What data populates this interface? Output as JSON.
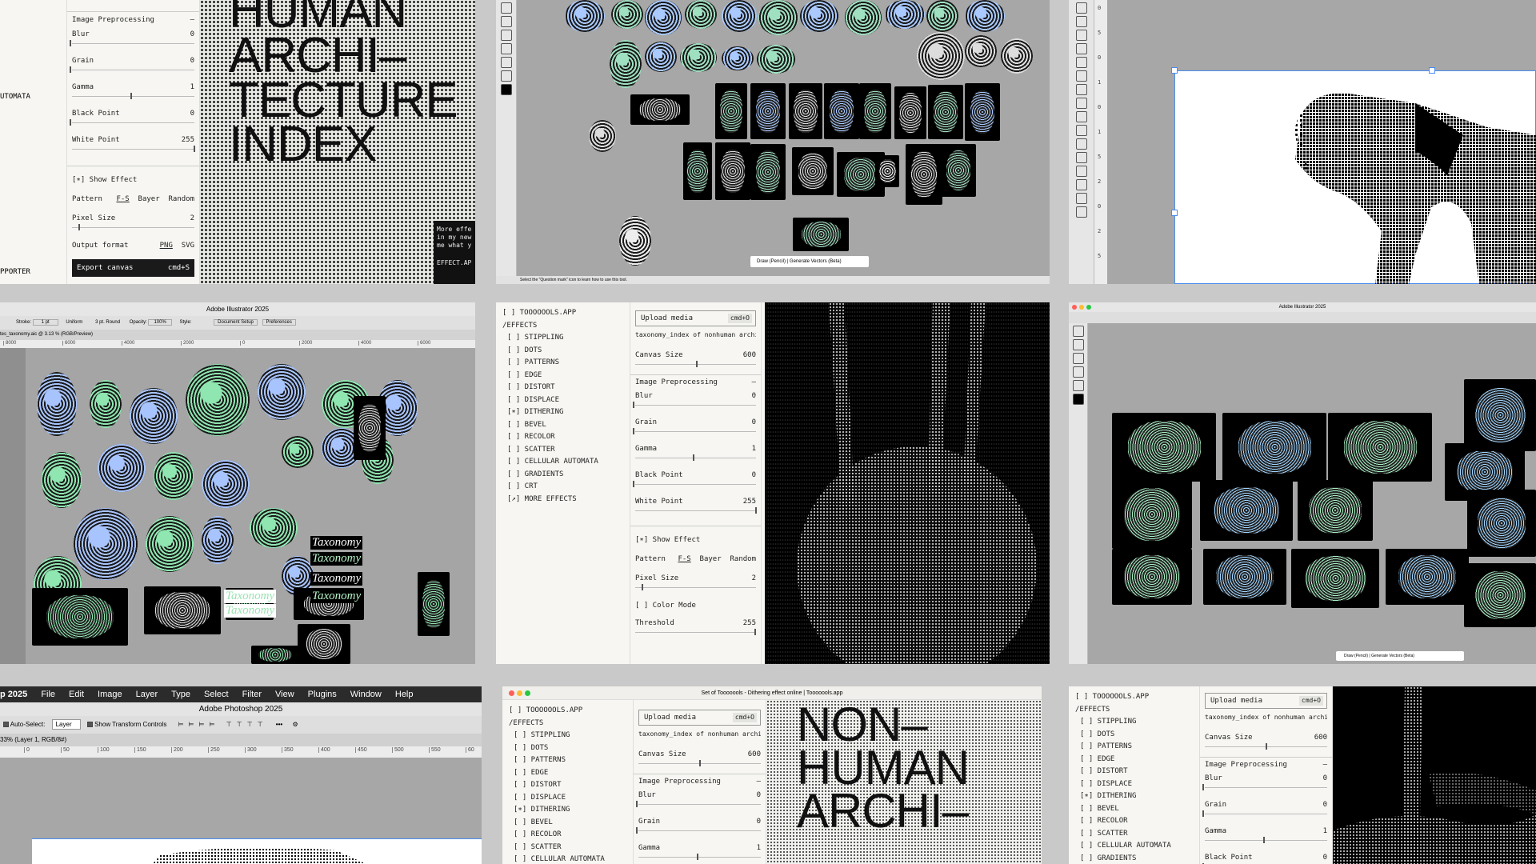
{
  "colors": {
    "accent": "#a7f3c8",
    "organism_green": "#7be0a8",
    "organism_blue": "#9bc8ff",
    "dark": "#111111",
    "panel_bg": "#f7f6f2"
  },
  "cell1": {
    "section_title": "Image Preprocessing",
    "left_text_1": "UTOMATA",
    "left_text_2": "PPORTER",
    "sliders": [
      {
        "label": "Blur",
        "value": "0"
      },
      {
        "label": "Grain",
        "value": "0"
      },
      {
        "label": "Gamma",
        "value": "1"
      },
      {
        "label": "Black Point",
        "value": "0"
      },
      {
        "label": "White Point",
        "value": "255"
      }
    ],
    "show_effect": "[∗] Show Effect",
    "pattern_label": "Pattern",
    "pattern_options": [
      "F-S",
      "Bayer",
      "Random"
    ],
    "pixel_size_label": "Pixel Size",
    "pixel_size_value": "2",
    "output_label": "Output format",
    "output_options": [
      "PNG",
      "SVG"
    ],
    "export_label": "Export canvas",
    "export_shortcut": "cmd+S",
    "title_lines": [
      "HUMAN",
      "ARCHI–",
      "TECTURE",
      "INDEX"
    ],
    "note_lines": [
      "More effe",
      "in my new",
      "me what y"
    ],
    "note_link": "EFFECT.AP"
  },
  "cell2": {
    "status": "Select the \"Question mark\" icon to learn how to use this tool.",
    "tasks": [
      "Draw (Pencil)",
      "Generate Vectors (Beta)"
    ]
  },
  "cell3": {
    "ruler_ticks": [
      "0",
      "5",
      "0",
      "1",
      "0",
      "1",
      "5",
      "2",
      "0",
      "2",
      "5"
    ]
  },
  "cell4": {
    "title": "Adobe Illustrator 2025",
    "stroke_label": "Stroke:",
    "stroke_value": "1 pt",
    "uniform": "Uniform",
    "round": "3 pt. Round",
    "opacity_label": "Opacity:",
    "opacity_value": "100%",
    "style_label": "Style:",
    "doc_setup": "Document Setup",
    "preferences": "Preferences",
    "tab": "tes_taxonomy.aic @ 3.13 % (RGB/Preview)",
    "ruler": [
      "8000",
      "6000",
      "4000",
      "2000",
      "0",
      "2000",
      "4000",
      "6000"
    ],
    "taxonomy_words": [
      "Taxonomy",
      "Taxonomy",
      "Taxonomy",
      "Taxonomy",
      "Taxonomy",
      "Taxonomy"
    ]
  },
  "effects_list": [
    "[ ] TOOOOOOLS.APP",
    "/EFFECTS",
    "[ ] STIPPLING",
    "[ ] DOTS",
    "[ ] PATTERNS",
    "[ ] EDGE",
    "[ ] DISTORT",
    "[ ] DISPLACE",
    "[∗] DITHERING",
    "[ ] BEVEL",
    "[ ] RECOLOR",
    "[ ] SCATTER",
    "[ ] CELLULAR AUTOMATA",
    "[ ] GRADIENTS",
    "[ ] CRT",
    "[↗] MORE EFFECTS"
  ],
  "cell5": {
    "upload_label": "Upload media",
    "upload_shortcut": "cmd+O",
    "filename": "taxonomy_index of nonhuman archite…",
    "canvas_label": "Canvas Size",
    "canvas_value": "600",
    "section_title": "Image Preprocessing",
    "sliders": [
      {
        "label": "Blur",
        "value": "0"
      },
      {
        "label": "Grain",
        "value": "0"
      },
      {
        "label": "Gamma",
        "value": "1"
      },
      {
        "label": "Black Point",
        "value": "0"
      },
      {
        "label": "White Point",
        "value": "255"
      }
    ],
    "show_effect": "[∗] Show Effect",
    "pattern_label": "Pattern",
    "pattern_options": [
      "F-S",
      "Bayer",
      "Random"
    ],
    "pixel_size_label": "Pixel Size",
    "pixel_size_value": "2",
    "color_mode": "[ ] Color Mode",
    "threshold_label": "Threshold",
    "threshold_value": "255"
  },
  "cell6": {
    "title": "Adobe Illustrator 2025",
    "tasks": [
      "Draw (Pencil)",
      "Generate Vectors (Beta)"
    ]
  },
  "cell7": {
    "app": "p 2025",
    "menu": [
      "File",
      "Edit",
      "Image",
      "Layer",
      "Type",
      "Select",
      "Filter",
      "View",
      "Plugins",
      "Window",
      "Help"
    ],
    "title": "Adobe Photoshop 2025",
    "auto_select": "Auto-Select:",
    "layer_value": "Layer",
    "transform": "Show Transform Controls",
    "tab": "33% (Layer 1, RGB/8#)",
    "ruler": [
      "0",
      "50",
      "100",
      "150",
      "200",
      "250",
      "300",
      "350",
      "400",
      "450",
      "500",
      "550",
      "60"
    ]
  },
  "cell8": {
    "window_title": "Set of Tooooools - Dithering effect online | Tooooools.app",
    "effects": [
      "[ ] TOOOOOOLS.APP",
      "/EFFECTS",
      "[ ] STIPPLING",
      "[ ] DOTS",
      "[ ] PATTERNS",
      "[ ] EDGE",
      "[ ] DISTORT",
      "[ ] DISPLACE",
      "[∗] DITHERING",
      "[ ] BEVEL",
      "[ ] RECOLOR",
      "[ ] SCATTER",
      "[ ] CELLULAR AUTOMATA"
    ],
    "upload_label": "Upload media",
    "upload_shortcut": "cmd+O",
    "filename": "taxonomy_index of nonhuman archite…",
    "canvas_label": "Canvas Size",
    "canvas_value": "600",
    "section_title": "Image Preprocessing",
    "sliders": [
      {
        "label": "Blur",
        "value": "0"
      },
      {
        "label": "Grain",
        "value": "0"
      },
      {
        "label": "Gamma",
        "value": "1"
      }
    ],
    "title_lines": [
      "NON–",
      "HUMAN",
      "ARCHI–"
    ]
  },
  "cell9": {
    "effects": [
      "[ ] TOOOOOOLS.APP",
      "/EFFECTS",
      "[ ] STIPPLING",
      "[ ] DOTS",
      "[ ] PATTERNS",
      "[ ] EDGE",
      "[ ] DISTORT",
      "[ ] DISPLACE",
      "[∗] DITHERING",
      "[ ] BEVEL",
      "[ ] RECOLOR",
      "[ ] SCATTER",
      "[ ] CELLULAR AUTOMATA",
      "[ ] GRADIENTS"
    ],
    "upload_label": "Upload media",
    "upload_shortcut": "cmd+O",
    "filename": "taxonomy_index of nonhuman archite…",
    "canvas_label": "Canvas Size",
    "canvas_value": "600",
    "section_title": "Image Preprocessing",
    "sliders": [
      {
        "label": "Blur",
        "value": "0"
      },
      {
        "label": "Grain",
        "value": "0"
      },
      {
        "label": "Gamma",
        "value": "1"
      },
      {
        "label": "Black Point",
        "value": "0"
      }
    ]
  }
}
